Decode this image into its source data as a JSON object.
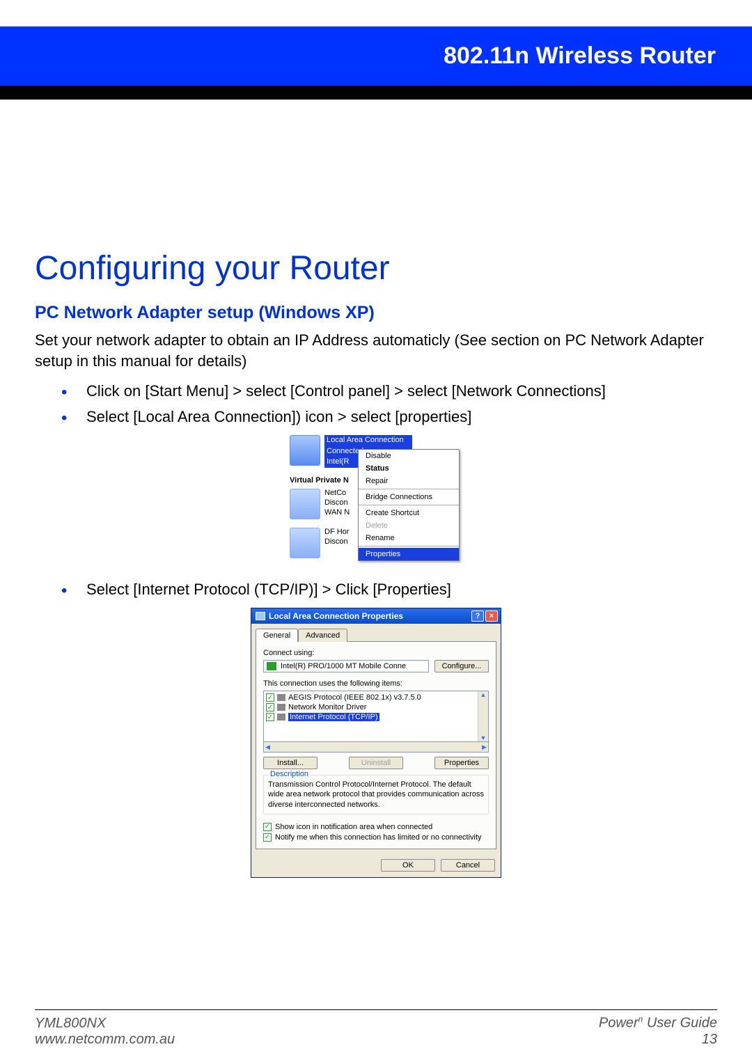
{
  "header": {
    "product_line": "802.11n Wireless Router"
  },
  "page": {
    "title": "Configuring your Router",
    "section_heading": "PC Network Adapter setup (Windows XP)",
    "intro": "Set your network adapter to obtain an IP Address automaticly (See section on PC Network Adapter setup in this manual for details)",
    "bullets": [
      "Click on [Start Menu] > select [Control panel] > select [Network Connections]",
      "Select [Local Area Connection]) icon > select [properties]"
    ],
    "bullet_after_fig1": "Select [Internet Protocol (TCP/IP)] > Click [Properties]"
  },
  "fig1": {
    "lac_title_l1": "Local Area Connection",
    "lac_title_l2": "Connected",
    "lac_title_l3": "Intel(R",
    "vpn_header": "Virtual Private N",
    "item2_l1": "NetCo",
    "item2_l2": "Discon",
    "item2_l3": "WAN N",
    "item3_l1": "DF Hor",
    "item3_l2": "Discon",
    "menu": {
      "disable": "Disable",
      "status": "Status",
      "repair": "Repair",
      "bridge": "Bridge Connections",
      "shortcut": "Create Shortcut",
      "delete": "Delete",
      "rename": "Rename",
      "properties": "Properties"
    }
  },
  "fig2": {
    "title": "Local Area Connection Properties",
    "tabs": {
      "general": "General",
      "advanced": "Advanced"
    },
    "connect_using_label": "Connect using:",
    "adapter_name": "Intel(R) PRO/1000 MT Mobile Conne",
    "configure_btn": "Configure...",
    "items_label": "This connection uses the following items:",
    "items": {
      "aegis": "AEGIS Protocol (IEEE 802.1x) v3.7.5.0",
      "nmd": "Network Monitor Driver",
      "tcpip": "Internet Protocol (TCP/IP)"
    },
    "install_btn": "Install...",
    "uninstall_btn": "Uninstall",
    "properties_btn": "Properties",
    "desc_legend": "Description",
    "desc_text": "Transmission Control Protocol/Internet Protocol. The default wide area network protocol that provides communication across diverse interconnected networks.",
    "cb_showicon": "Show icon in notification area when connected",
    "cb_notify": "Notify me when this connection has limited or no connectivity",
    "ok_btn": "OK",
    "cancel_btn": "Cancel"
  },
  "footer": {
    "model": "YML800NX",
    "url": "www.netcomm.com.au",
    "brand_prefix": "Power",
    "brand_sup": "n",
    "guide": " User Guide",
    "page_num": "13"
  }
}
